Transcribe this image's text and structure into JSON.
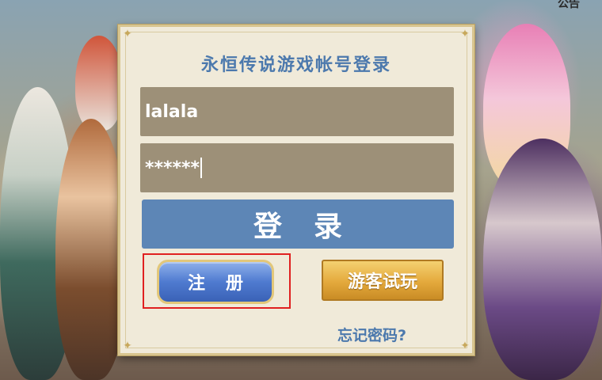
{
  "corner_text": "公告",
  "dialog": {
    "title": "永恒传说游戏帐号登录",
    "username_value": "lalala",
    "password_value": "******",
    "login_label": "登录",
    "register_label": "注册",
    "guest_label": "游客试玩",
    "forgot_label": "忘记密码?"
  },
  "colors": {
    "title": "#4c79ad",
    "login_button": "#5d86b6",
    "register_button": "#4f7bd0",
    "guest_button": "#e4a93c",
    "highlight": "#e02020"
  }
}
